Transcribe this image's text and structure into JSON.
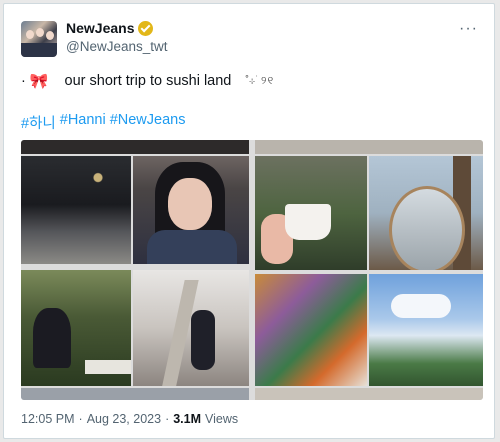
{
  "account": {
    "display_name": "NewJeans",
    "handle": "@NewJeans_twt",
    "verified_badge_color": "#e2b719"
  },
  "tweet": {
    "prefix_dot": "·",
    "bow_emoji": "🎀",
    "text": "our short trip to sushi land",
    "decoration": "˚⊹ ࣪ ୨୧",
    "hashtags": [
      "#하니",
      "#Hanni",
      "#NewJeans"
    ]
  },
  "media": {
    "left_column_photos": [
      "night-street-photo",
      "selfie-photo",
      "park-photo",
      "stairs-photo"
    ],
    "right_column_photos": [
      "ice-cream-cup-photo",
      "mirror-tree-photo",
      "paint-palette-photo",
      "city-sky-photo"
    ]
  },
  "meta": {
    "time": "12:05 PM",
    "separator": "·",
    "date": "Aug 23, 2023",
    "views_count": "3.1M",
    "views_label": "Views"
  },
  "colors": {
    "link": "#1d9bf0",
    "secondary_text": "#536471",
    "primary_text": "#0f1419"
  },
  "icons": {
    "more": "more-options-icon",
    "verified": "verified-badge-icon"
  }
}
